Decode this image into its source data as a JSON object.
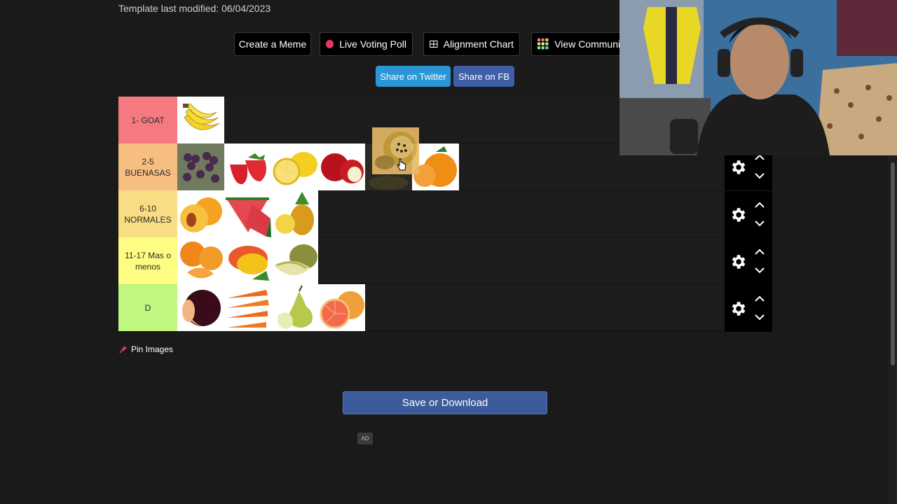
{
  "template": {
    "last_modified": "Template last modified: 06/04/2023"
  },
  "toolbar": {
    "create_meme": "Create a Meme",
    "live_voting": "Live Voting Poll",
    "alignment_chart": "Alignment Chart",
    "view_community": "View Communit"
  },
  "share": {
    "twitter": "Share on Twitter",
    "fb": "Share on FB"
  },
  "tiers": [
    {
      "label": "1- GOAT",
      "color": "#f47a80",
      "items": [
        "banana"
      ]
    },
    {
      "label": "2-5 BUENASAS",
      "color": "#f7be81",
      "items": [
        "grapes",
        "strawberry",
        "lemon",
        "apple",
        "passion-fruit-slot",
        "orange"
      ]
    },
    {
      "label": "6-10 NORMALES",
      "color": "#f8dd84",
      "items": [
        "peach",
        "watermelon",
        "pineapple"
      ]
    },
    {
      "label": "11-17 Mas o menos",
      "color": "#fcfd82",
      "items": [
        "tangerine",
        "mango",
        "melon"
      ]
    },
    {
      "label": "D",
      "color": "#bff781",
      "items": [
        "plum",
        "carrot",
        "pear",
        "grapefruit"
      ]
    }
  ],
  "dragged_item": "passion-fruit",
  "pin_images": "Pin Images",
  "save": "Save or Download",
  "ad": "AD",
  "icons": [
    "gear-icon",
    "chevron-up-icon",
    "chevron-down-icon",
    "pin-icon",
    "grid-icon",
    "cursor-icon"
  ]
}
